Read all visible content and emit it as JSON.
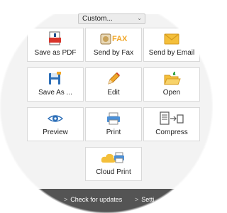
{
  "dropdown": {
    "value": "Custom..."
  },
  "tiles": [
    {
      "label": "Save as PDF",
      "icon": "pdf-icon"
    },
    {
      "label": "Send by Fax",
      "icon": "fax-icon",
      "icon_text": "FAX"
    },
    {
      "label": "Send by Email",
      "icon": "email-icon"
    },
    {
      "label": "Save As ...",
      "icon": "save-as-icon"
    },
    {
      "label": "Edit",
      "icon": "pencil-icon"
    },
    {
      "label": "Open",
      "icon": "open-folder-icon"
    },
    {
      "label": "Preview",
      "icon": "eye-icon"
    },
    {
      "label": "Print",
      "icon": "printer-icon"
    },
    {
      "label": "Compress",
      "icon": "compress-icon"
    },
    {
      "label": "Cloud Print",
      "icon": "cloud-print-icon"
    }
  ],
  "footer": {
    "items": [
      {
        "label": "Check for updates"
      },
      {
        "label": "Setti"
      }
    ]
  },
  "colors": {
    "accent_orange": "#f0a72a",
    "pdf_red": "#d9342b",
    "blue": "#2d6fb8",
    "footer_bg": "#545454"
  }
}
